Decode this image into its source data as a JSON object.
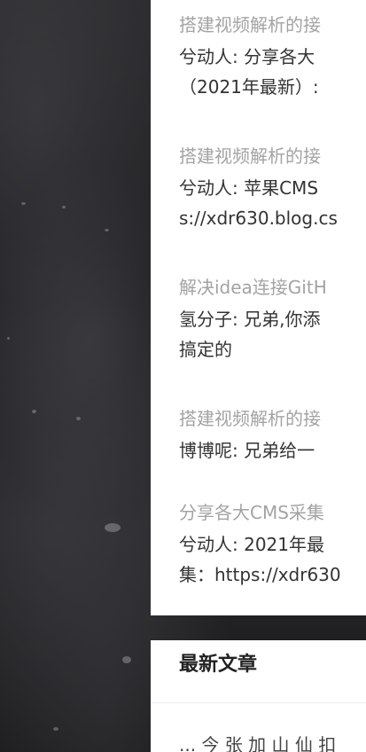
{
  "comments": [
    {
      "title": "搭建视频解析的接",
      "lines": [
        "兮动人: 分享各大",
        "（2021年最新）:"
      ]
    },
    {
      "title": "搭建视频解析的接",
      "lines": [
        "兮动人: 苹果CMS",
        "s://xdr630.blog.cs"
      ]
    },
    {
      "title": "解决idea连接GitH",
      "lines": [
        "氢分子: 兄弟,你添",
        "搞定的"
      ]
    },
    {
      "title": "搭建视频解析的接",
      "lines": [
        "博博呢: 兄弟给一"
      ]
    },
    {
      "title": "分享各大CMS采集",
      "lines": [
        "兮动人: 2021年最",
        "集：https://xdr630"
      ]
    }
  ],
  "latest": {
    "heading": "最新文章",
    "first_item": "... 今 张 加 山 仙 扣"
  }
}
